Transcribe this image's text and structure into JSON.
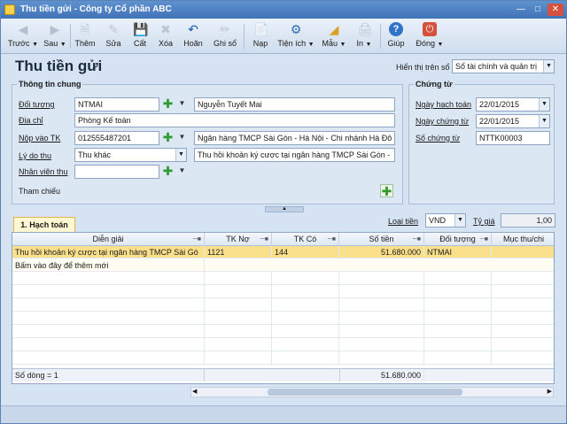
{
  "window": {
    "title": "Thu tiền gửi - Công ty Cổ phần ABC"
  },
  "toolbar": {
    "truoc": "Trước",
    "sau": "Sau",
    "them": "Thêm",
    "sua": "Sửa",
    "cat": "Cất",
    "xoa": "Xóa",
    "hoan": "Hoãn",
    "ghiso": "Ghi sổ",
    "nap": "Nạp",
    "tienich": "Tiện ích",
    "mau": "Mẫu",
    "in": "In",
    "giup": "Giúp",
    "dong": "Đóng"
  },
  "header": {
    "title": "Thu tiền gửi",
    "display_label": "Hiển thị trên sổ",
    "display_value": "Sổ tài chính và quản trị"
  },
  "general": {
    "title": "Thông tin chung",
    "doituong_label": "Đối tượng",
    "doituong_code": "NTMAI",
    "doituong_name": "Nguyễn Tuyết Mai",
    "diachi_label": "Địa chỉ",
    "diachi_value": "Phòng Kế toán",
    "nopvao_label": "Nộp vào TK",
    "nopvao_value": "012555487201",
    "nopvao_bank": "Ngân hàng TMCP Sài Gòn - Hà Nội - Chi nhánh Hà Đô",
    "lydo_label": "Lý do thu",
    "lydo_value": "Thu khác",
    "lydo_desc": "Thu hồi khoản ký cược tại ngân hàng TMCP Sài Gòn -",
    "nhanvien_label": "Nhân viên thu",
    "nhanvien_value": "",
    "thamchieu_label": "Tham chiếu"
  },
  "voucher": {
    "title": "Chứng từ",
    "ngayhachtoan_label": "Ngày hạch toán",
    "ngayhachtoan_value": "22/01/2015",
    "ngaychungtu_label": "Ngày chứng từ",
    "ngaychungtu_value": "22/01/2015",
    "sochungtu_label": "Số chứng từ",
    "sochungtu_value": "NTTK00003"
  },
  "currency": {
    "loaitien_label": "Loại tiền",
    "loaitien_value": "VND",
    "tygia_label": "Tỷ giá",
    "tygia_value": "1,00"
  },
  "grid": {
    "tab": "1. Hạch toán",
    "columns": [
      "Diễn giải",
      "TK Nợ",
      "TK Có",
      "Số tiền",
      "Đối tượng",
      "Mục thu/chi"
    ],
    "rows": [
      [
        "Thu hồi khoản ký cược tại ngân hàng TMCP Sài Gò",
        "1121",
        "144",
        "51.680.000",
        "NTMAI",
        ""
      ]
    ],
    "add_hint": "Bấm vào đây để thêm mới",
    "footer_count": "Số dòng = 1",
    "footer_total": "51.680.000"
  },
  "colors": {
    "selected_row": "#fbe08c",
    "titlebar": "#3f73b8"
  }
}
